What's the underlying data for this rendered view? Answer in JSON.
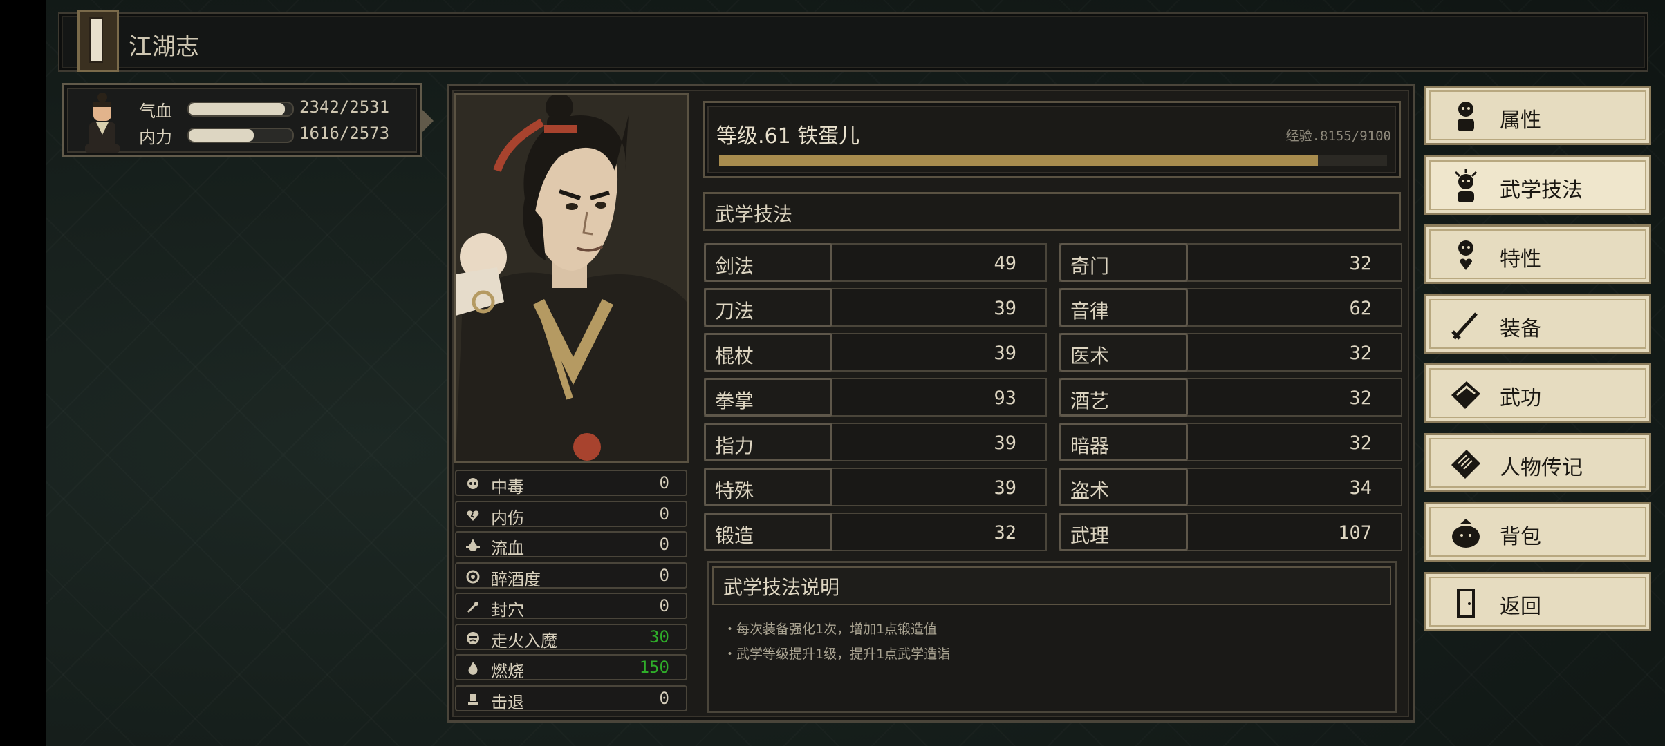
{
  "window": {
    "title": "江湖志"
  },
  "vitals": {
    "hp": {
      "label": "气血",
      "value": "2342/2531",
      "fraction": 0.925
    },
    "mp": {
      "label": "内力",
      "value": "1616/2573",
      "fraction": 0.628
    }
  },
  "status": [
    {
      "icon": "skull-icon",
      "name": "中毒",
      "value": "0",
      "highlight": false
    },
    {
      "icon": "broken-heart-icon",
      "name": "内伤",
      "value": "0",
      "highlight": false
    },
    {
      "icon": "blood-drop-icon",
      "name": "流血",
      "value": "0",
      "highlight": false
    },
    {
      "icon": "dizzy-face-icon",
      "name": "醉酒度",
      "value": "0",
      "highlight": false
    },
    {
      "icon": "acupoint-icon",
      "name": "封穴",
      "value": "0",
      "highlight": false
    },
    {
      "icon": "demon-face-icon",
      "name": "走火入魔",
      "value": "30",
      "highlight": true
    },
    {
      "icon": "flame-icon",
      "name": "燃烧",
      "value": "150",
      "highlight": true
    },
    {
      "icon": "knockback-icon",
      "name": "击退",
      "value": "0",
      "highlight": false
    }
  ],
  "character": {
    "level_text": "等级.61 铁蛋儿",
    "exp_text": "经验.8155/9100",
    "exp_fraction": 0.896
  },
  "section_title": "武学技法",
  "skills_left": [
    {
      "name": "剑法",
      "value": "49"
    },
    {
      "name": "刀法",
      "value": "39"
    },
    {
      "name": "棍杖",
      "value": "39"
    },
    {
      "name": "拳掌",
      "value": "93"
    },
    {
      "name": "指力",
      "value": "39"
    },
    {
      "name": "特殊",
      "value": "39"
    },
    {
      "name": "锻造",
      "value": "32"
    }
  ],
  "skills_right": [
    {
      "name": "奇门",
      "value": "32"
    },
    {
      "name": "音律",
      "value": "62"
    },
    {
      "name": "医术",
      "value": "32"
    },
    {
      "name": "酒艺",
      "value": "32"
    },
    {
      "name": "暗器",
      "value": "32"
    },
    {
      "name": "盗术",
      "value": "34"
    },
    {
      "name": "武理",
      "value": "107"
    }
  ],
  "description": {
    "title": "武学技法说明",
    "lines": [
      "・每次装备强化1次，增加1点锻造值",
      "・武学等级提升1级，提升1点武学造诣"
    ]
  },
  "menu": [
    {
      "icon": "person-icon",
      "label": "属性",
      "active": false
    },
    {
      "icon": "martial-person-icon",
      "label": "武学技法",
      "active": true
    },
    {
      "icon": "trait-person-icon",
      "label": "特性",
      "active": false
    },
    {
      "icon": "sword-icon",
      "label": "装备",
      "active": false
    },
    {
      "icon": "book-icon",
      "label": "武功",
      "active": false
    },
    {
      "icon": "scroll-icon",
      "label": "人物传记",
      "active": false
    },
    {
      "icon": "bag-icon",
      "label": "背包",
      "active": false
    },
    {
      "icon": "door-icon",
      "label": "返回",
      "active": false
    }
  ],
  "colors": {
    "accent_gold": "#a88c4e",
    "status_high": "#2fae2a",
    "menu_bg": "#e6dcc0"
  }
}
